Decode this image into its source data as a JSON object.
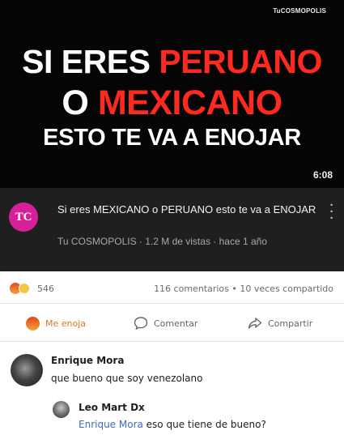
{
  "video": {
    "watermark": "TuCOSMOPOLIS",
    "line1_white": "SI ERES ",
    "line1_red": "PERUANO",
    "line2_white": "O ",
    "line2_red": "MEXICANO",
    "line3": "ESTO TE VA A ENOJAR",
    "duration": "6:08"
  },
  "meta": {
    "avatar_text": "TC",
    "title": "Si eres MEXICANO o PERUANO esto te va a ENOJAR",
    "subline": "Tu COSMOPOLIS · 1.2 M de vistas · hace 1 año",
    "more_icon": "more-vertical-icon"
  },
  "stats": {
    "reactions_count": "546",
    "comments_shares": "116 comentarios • 10 veces compartido"
  },
  "actions": {
    "react_label": "Me enoja",
    "comment_label": "Comentar",
    "share_label": "Compartir"
  },
  "comments": [
    {
      "name": "Enrique Mora",
      "text": "que bueno que soy venezolano"
    },
    {
      "name": "Leo Mart Dx",
      "mention": "Enrique Mora",
      "text": " eso que tiene de bueno?"
    }
  ],
  "colors": {
    "accent_red": "#ff2a1f",
    "avatar": "#d6209a",
    "mention": "#3b6bc4",
    "react": "#e2751d"
  }
}
